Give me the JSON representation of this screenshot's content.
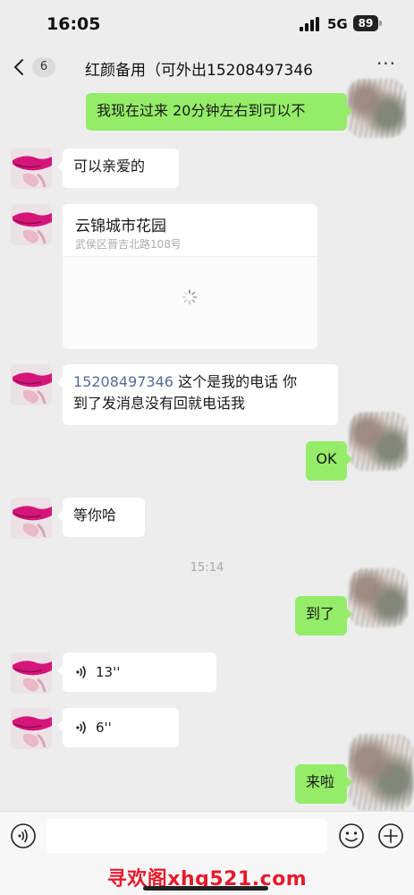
{
  "status_bar": {
    "time": "16:05",
    "network": "5G",
    "battery": "89"
  },
  "nav": {
    "unread_count": "6",
    "title": "红颜备用（可外出15208497346",
    "more_label": "···"
  },
  "messages": {
    "out_1": "我现在过来 20分钟左右到可以不",
    "in_1": "可以亲爱的",
    "location_name": "云锦城市花园",
    "location_address": "武侯区晋吉北路108号",
    "in_phone_number": "15208497346",
    "in_phone_text_1": " 这个是我的电话 你",
    "in_phone_text_2": "到了发消息没有回就电话我",
    "out_2": "OK",
    "in_2": "等你哈",
    "time_divider": "15:14",
    "out_3": "到了",
    "voice_1_duration": "13''",
    "voice_2_duration": "6''",
    "out_4": "来啦"
  },
  "input": {
    "placeholder": ""
  },
  "watermark": "寻欢阁xhg521.com",
  "colors": {
    "background": "#ededed",
    "outgoing_bubble": "#95ec69",
    "incoming_bubble": "#ffffff",
    "link": "#576b95",
    "watermark": "#e8192c"
  },
  "icons": {
    "back": "chevron-left-icon",
    "more": "more-dots-icon",
    "voice": "voice-wave-icon",
    "voice_input": "voice-input-icon",
    "emoji": "emoji-icon",
    "plus": "plus-icon",
    "loading": "spinner-icon"
  }
}
